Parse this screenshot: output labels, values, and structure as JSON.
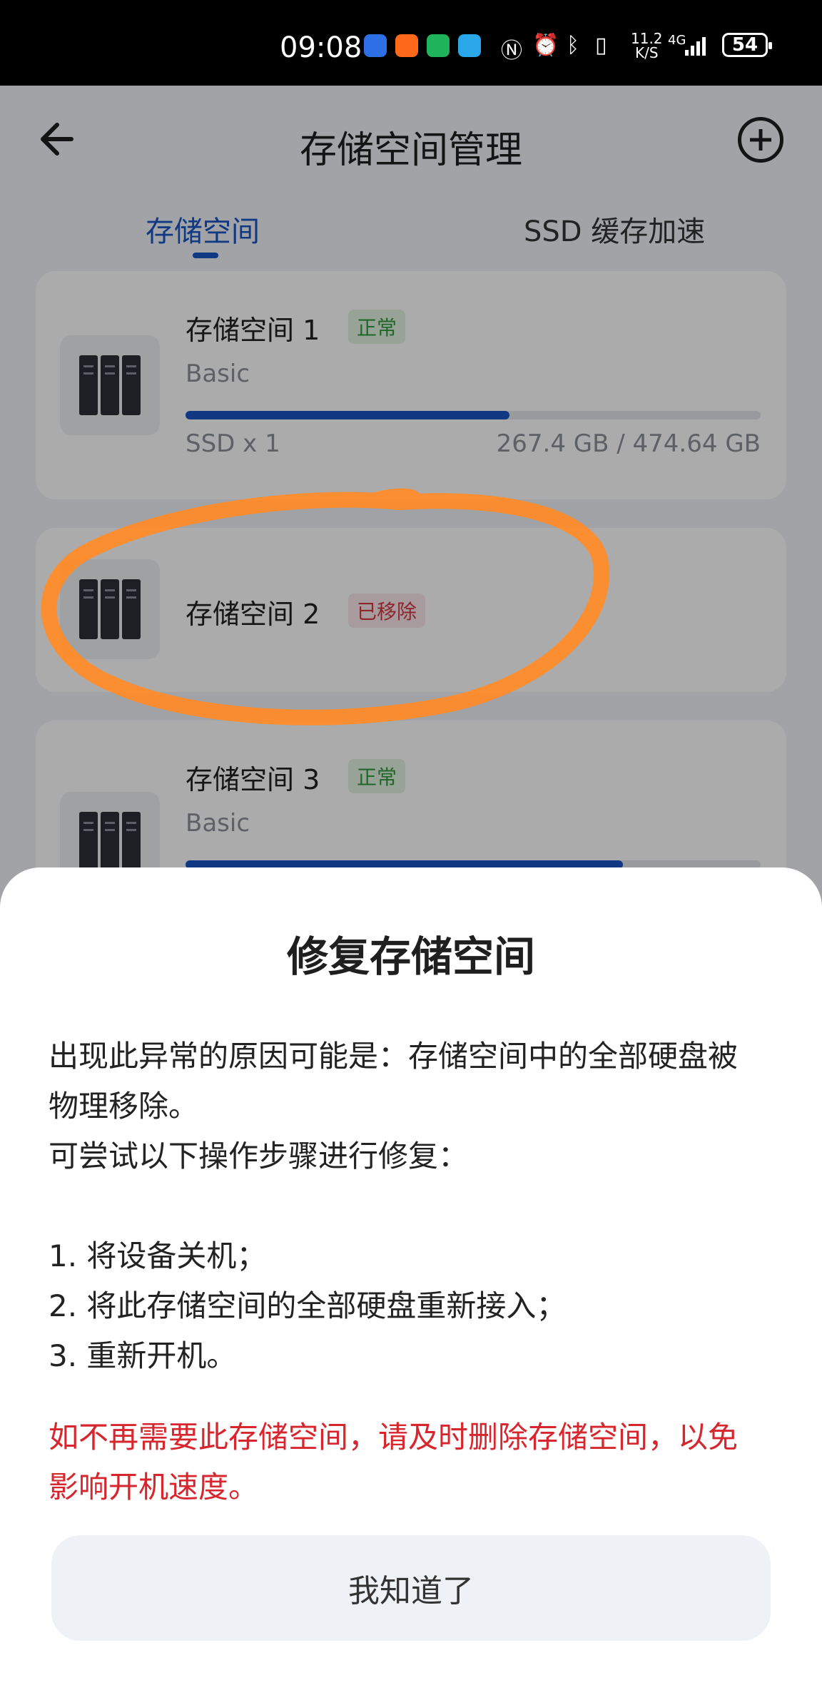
{
  "status_bar": {
    "time": "09:08",
    "net_speed_value": "11.2",
    "net_speed_unit": "K/S",
    "network": "4G",
    "battery": "54"
  },
  "header": {
    "title": "存储空间管理"
  },
  "tabs": [
    {
      "label": "存储空间",
      "active": true
    },
    {
      "label": "SSD 缓存加速",
      "active": false
    }
  ],
  "storage_pools": [
    {
      "name": "存储空间 1",
      "status": "正常",
      "type": "Basic",
      "usage_fraction": 0.563,
      "disks": "SSD x 1",
      "capacity": "267.4 GB / 474.64 GB"
    },
    {
      "name": "存储空间 2",
      "status": "已移除"
    },
    {
      "name": "存储空间 3",
      "status": "正常",
      "type": "Basic",
      "usage_fraction": 0.76
    }
  ],
  "dialog": {
    "title": "修复存储空间",
    "paragraphs": [
      "出现此异常的原因可能是：存储空间中的全部硬盘被物理移除。",
      "可尝试以下操作步骤进行修复：",
      "",
      "1. 将设备关机；",
      "2. 将此存储空间的全部硬盘重新接入；",
      "3. 重新开机。"
    ],
    "warning": "如不再需要此存储空间，请及时删除存储空间，以免影响开机速度。",
    "confirm_label": "我知道了"
  },
  "colors": {
    "accent": "#1a56c4",
    "status_ok": "#2f9a3d",
    "status_removed": "#d23a44",
    "warning_text": "#d7262e",
    "annotation": "#ff8c2a"
  }
}
